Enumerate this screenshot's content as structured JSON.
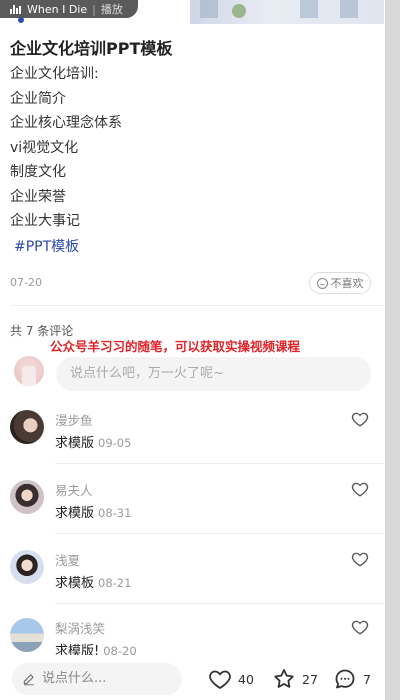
{
  "music": {
    "title": "When I Die",
    "action": "播放"
  },
  "note": {
    "title": "企业文化培训PPT模板",
    "lines": [
      "企业文化培训:",
      "企业简介",
      "企业核心理念体系",
      "vi视觉文化",
      "制度文化",
      "企业荣誉",
      "企业大事记"
    ],
    "tag": "#PPT模板",
    "date": "07-20",
    "dislike_label": "不喜欢"
  },
  "comments_header": "共 7 条评论",
  "watermark": "公众号羊习习的随笔，可以获取实操视频课程",
  "comment_input_placeholder": "说点什么吧，万一火了呢~",
  "comments": [
    {
      "name": "漫步鱼",
      "text": "求模版",
      "date": "09-05"
    },
    {
      "name": "易夫人",
      "text": "求模版",
      "date": "08-31"
    },
    {
      "name": "浅夏",
      "text": "求模板",
      "date": "08-21"
    },
    {
      "name": "梨涡浅笑",
      "text": "求模版!",
      "date": "08-20"
    }
  ],
  "bottom": {
    "say_placeholder": "说点什么...",
    "likes": "40",
    "collects": "27",
    "comments": "7"
  },
  "colors": {
    "tag": "#2a4aa8",
    "watermark": "#e0242a",
    "muted": "#9a9a9a"
  }
}
